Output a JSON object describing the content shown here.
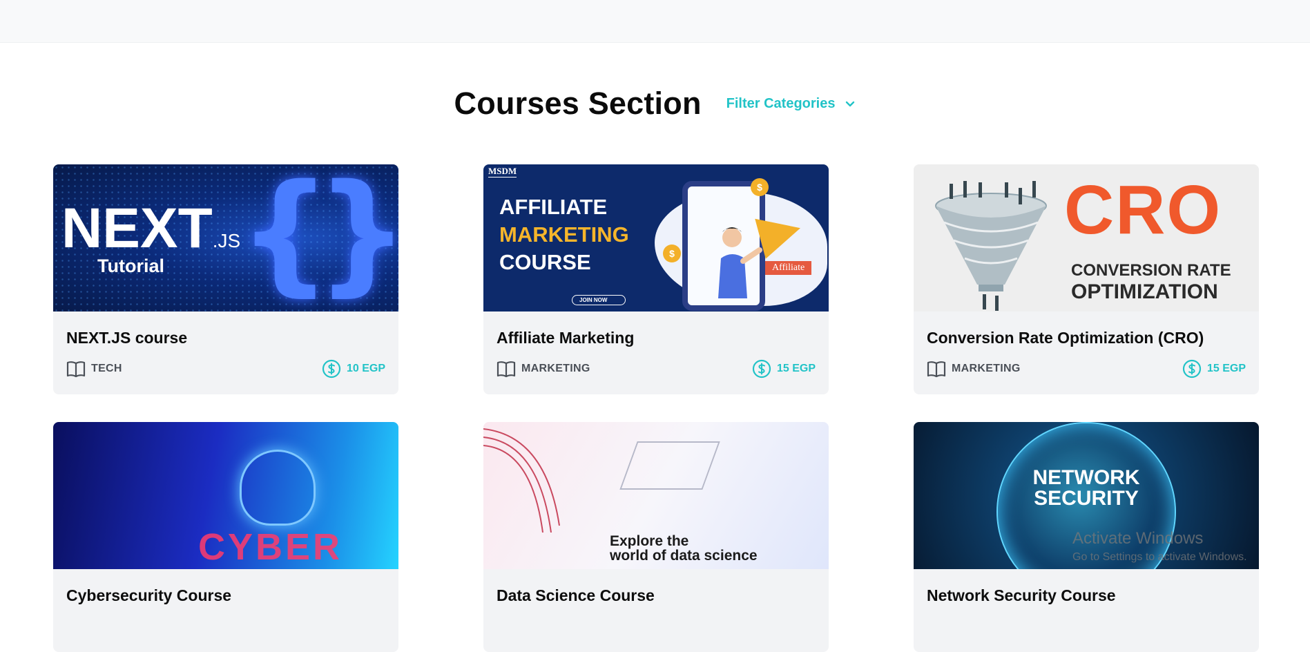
{
  "section": {
    "title": "Courses Section",
    "filter_label": "Filter Categories"
  },
  "courses": [
    {
      "title": "NEXT.JS course",
      "category": "TECH",
      "price": "10 EGP",
      "thumb": {
        "logo": "NEXT",
        "logo_suffix": ".JS",
        "subtitle": "Tutorial"
      }
    },
    {
      "title": "Affiliate Marketing",
      "category": "MARKETING",
      "price": "15 EGP",
      "thumb": {
        "brand": "MSDM",
        "line1": "AFFILIATE",
        "line2": "MARKETING",
        "line3": "COURSE",
        "tag": "Affiliate",
        "cta": "JOIN NOW"
      }
    },
    {
      "title": "Conversion Rate Optimization (CRO)",
      "category": "MARKETING",
      "price": "15 EGP",
      "thumb": {
        "big": "CRO",
        "line1": "CONVERSION RATE",
        "line2": "OPTIMIZATION"
      }
    },
    {
      "title": "Cybersecurity Course",
      "thumb": {
        "word": "CYBER"
      }
    },
    {
      "title": "Data Science Course",
      "thumb": {
        "line1": "Explore the",
        "line2": "world of data science"
      }
    },
    {
      "title": "Network Security Course",
      "thumb": {
        "line1": "NETWORK",
        "line2": "SECURITY"
      }
    }
  ],
  "watermark": {
    "line1": "Activate Windows",
    "line2": "Go to Settings to activate Windows."
  },
  "colors": {
    "accent": "#22c3c7",
    "card_bg": "#f2f3f5",
    "topbar": "#f8f9fa"
  },
  "icons": {
    "category": "book-icon",
    "price": "dollar-circle-icon",
    "filter": "chevron-down-icon"
  }
}
